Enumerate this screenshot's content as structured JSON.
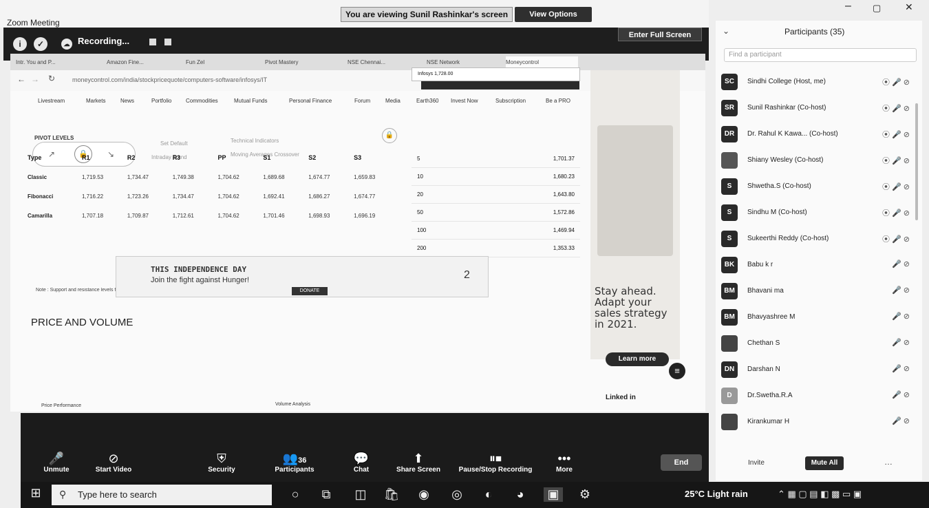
{
  "window": {
    "title": "Zoom Meeting",
    "viewing_banner": "You are viewing Sunil Rashinkar's screen",
    "view_options": "View Options",
    "minimize": "–",
    "maximize": "▢",
    "close": "✕"
  },
  "zoombar": {
    "recording_label": "Recording...",
    "full_screen": "Enter Full Screen"
  },
  "browser": {
    "tab_labels": [
      "Intr. You and P...",
      "Amazon Fine...",
      "Fun Zel",
      "Pivot Mastery",
      "NSE Chennai...",
      "NSE Network",
      "Moneycontrol"
    ],
    "url": "moneycontrol.com/india/stockpricequote/computers-software/infosys/IT",
    "nav_items": [
      "Livestream",
      "Markets",
      "News",
      "Portfolio",
      "Commodities",
      "Mutual Funds",
      "Personal Finance",
      "Forum",
      "Media",
      "Earth360",
      "Invest Now",
      "Subscription",
      "Be a PRO"
    ],
    "set_default": "Set Default",
    "intraday_trend": "Intraday Trend",
    "technical_indicators": "Technical Indicators",
    "moving_averages": "Moving Averages Crossover"
  },
  "pivot": {
    "label": "PIVOT LEVELS",
    "headers": [
      "Type",
      "R1",
      "R2",
      "R3",
      "PP",
      "S1",
      "S2",
      "S3"
    ],
    "rows": [
      {
        "type": "Classic",
        "vals": [
          "1,719.53",
          "1,734.47",
          "1,749.38",
          "1,704.62",
          "1,689.68",
          "1,674.77",
          "1,659.83"
        ]
      },
      {
        "type": "Fibonacci",
        "vals": [
          "1,716.22",
          "1,723.26",
          "1,734.47",
          "1,704.62",
          "1,692.41",
          "1,686.27",
          "1,674.77"
        ]
      },
      {
        "type": "Camarilla",
        "vals": [
          "1,707.18",
          "1,709.87",
          "1,712.61",
          "1,704.62",
          "1,701.46",
          "1,698.93",
          "1,696.19"
        ]
      }
    ],
    "note": "Note : Support and resistance levels for intraday, calculated based on close of previous trading day"
  },
  "mini_table": {
    "header": "Infosys 1,728.00",
    "rows": [
      {
        "d": "5",
        "v": "1,701.37"
      },
      {
        "d": "10",
        "v": "1,680.23"
      },
      {
        "d": "20",
        "v": "1,643.80"
      },
      {
        "d": "50",
        "v": "1,572.86"
      },
      {
        "d": "100",
        "v": "1,469.94"
      },
      {
        "d": "200",
        "v": "1,353.33"
      }
    ]
  },
  "ad": {
    "line1": "Stay ahead.",
    "line2": "Adapt your",
    "line3": "sales strategy",
    "line4": "in 2021.",
    "learn_more": "Learn more",
    "brand": "Linked in"
  },
  "banner": {
    "line1": "THIS INDEPENDENCE DAY",
    "line2": "Join the fight against Hunger!",
    "cta": "DONATE",
    "counter": "2"
  },
  "section_title": "PRICE AND VOLUME",
  "section_sub1": "Price Performance",
  "section_sub2": "Volume Analysis",
  "controls": {
    "unmute": "Unmute",
    "start_video": "Start Video",
    "security": "Security",
    "participants": "Participants",
    "participant_count": "36",
    "chat": "Chat",
    "share_screen": "Share Screen",
    "pause_stop": "Pause/Stop Recording",
    "more": "More",
    "end": "End"
  },
  "participants": {
    "title": "Participants (35)",
    "search_placeholder": "Find a participant",
    "invite": "Invite",
    "mute_all": "Mute All",
    "list": [
      {
        "initials": "SC",
        "name": "Sindhi College (Host, me)"
      },
      {
        "initials": "SR",
        "name": "Sunil Rashinkar (Co-host)"
      },
      {
        "initials": "DR",
        "name": "Dr. Rahul K Kawa... (Co-host)"
      },
      {
        "initials": "",
        "name": "Shiany Wesley (Co-host)"
      },
      {
        "initials": "S",
        "name": "Shwetha.S (Co-host)"
      },
      {
        "initials": "S",
        "name": "Sindhu M (Co-host)"
      },
      {
        "initials": "S",
        "name": "Sukeerthi Reddy (Co-host)"
      },
      {
        "initials": "BK",
        "name": "Babu k r"
      },
      {
        "initials": "BM",
        "name": "Bhavani ma"
      },
      {
        "initials": "BM",
        "name": "Bhavyashree M"
      },
      {
        "initials": "",
        "name": "Chethan S"
      },
      {
        "initials": "DN",
        "name": "Darshan N"
      },
      {
        "initials": "D",
        "name": "Dr.Swetha.R.A"
      },
      {
        "initials": "",
        "name": "Kirankumar H"
      }
    ]
  },
  "taskbar": {
    "search_placeholder": "Type here to search",
    "weather": "25°C  Light rain"
  }
}
